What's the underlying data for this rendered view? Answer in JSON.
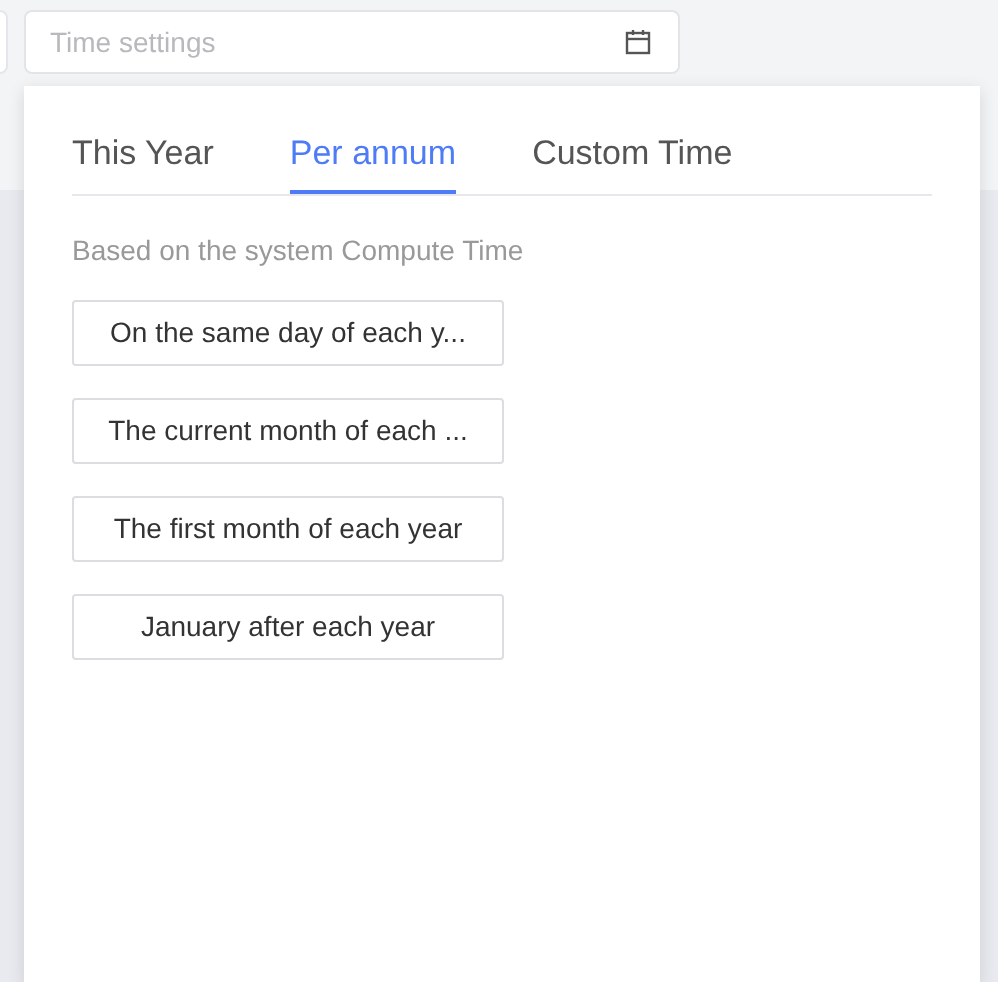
{
  "field": {
    "placeholder": "Time settings"
  },
  "tabs": [
    {
      "label": "This Year",
      "selected": false
    },
    {
      "label": "Per annum",
      "selected": true
    },
    {
      "label": "Custom Time",
      "selected": false
    }
  ],
  "hint": "Based on the system Compute Time",
  "options": [
    "On the same day of each y...",
    "The current month of each ...",
    "The first month of each year",
    "January after each year"
  ]
}
